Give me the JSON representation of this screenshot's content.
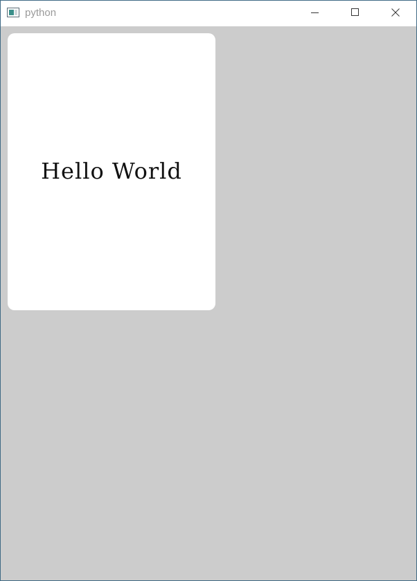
{
  "window": {
    "title": "python",
    "icons": {
      "app": "window-app-icon",
      "minimize": "minimize-icon",
      "maximize": "maximize-icon",
      "close": "close-icon"
    }
  },
  "content": {
    "label_text": "Hello World"
  },
  "colors": {
    "client_background": "#cccccc",
    "card_background": "#ffffff",
    "window_border": "#3f6a85",
    "title_text": "#9a9a9a"
  }
}
